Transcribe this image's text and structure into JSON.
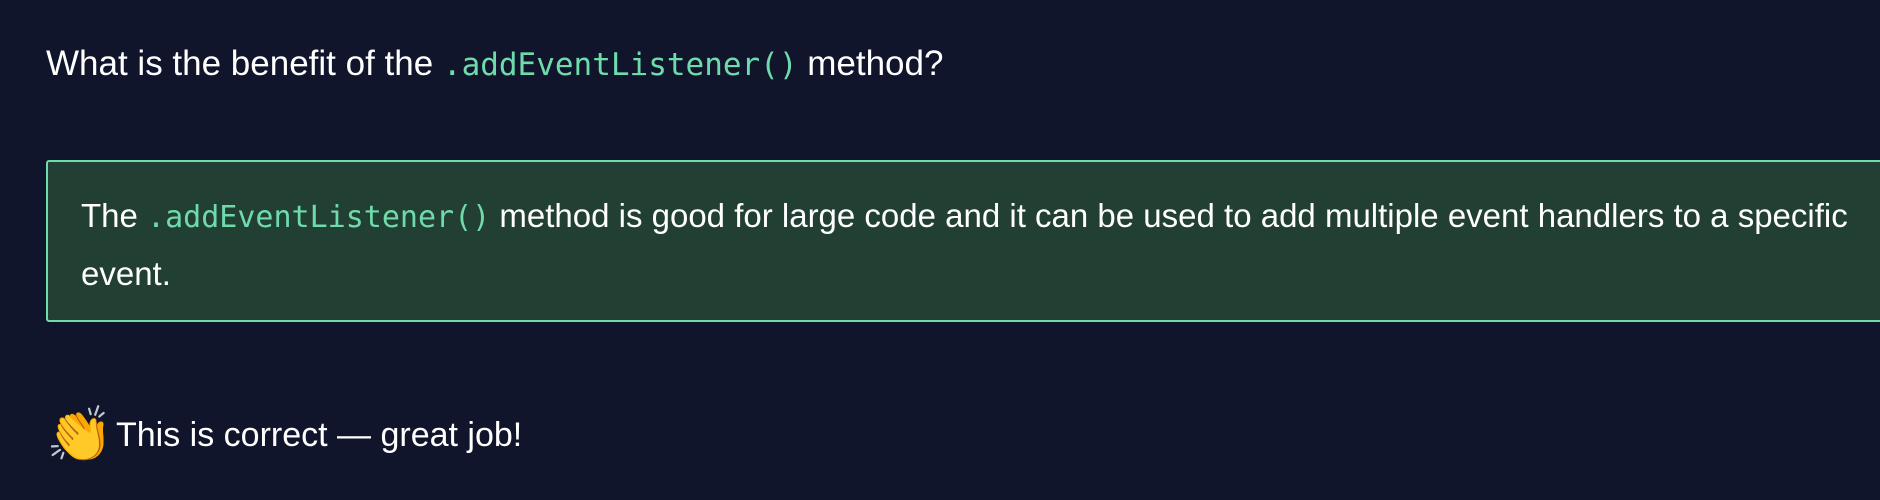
{
  "question": {
    "prefix": "What is the benefit of the ",
    "code": ".addEventListener()",
    "suffix": " method?"
  },
  "answer": {
    "prefix": "The ",
    "code": ".addEventListener()",
    "suffix": " method is good for large code and it can be used to add multiple event handlers to a specific event."
  },
  "feedback": {
    "icon": "clapping-hands-icon",
    "emoji": "👏",
    "text": "This is correct — great job!"
  },
  "colors": {
    "background": "#10152b",
    "accent": "#6fdbab",
    "answer_background": "#223f33"
  }
}
